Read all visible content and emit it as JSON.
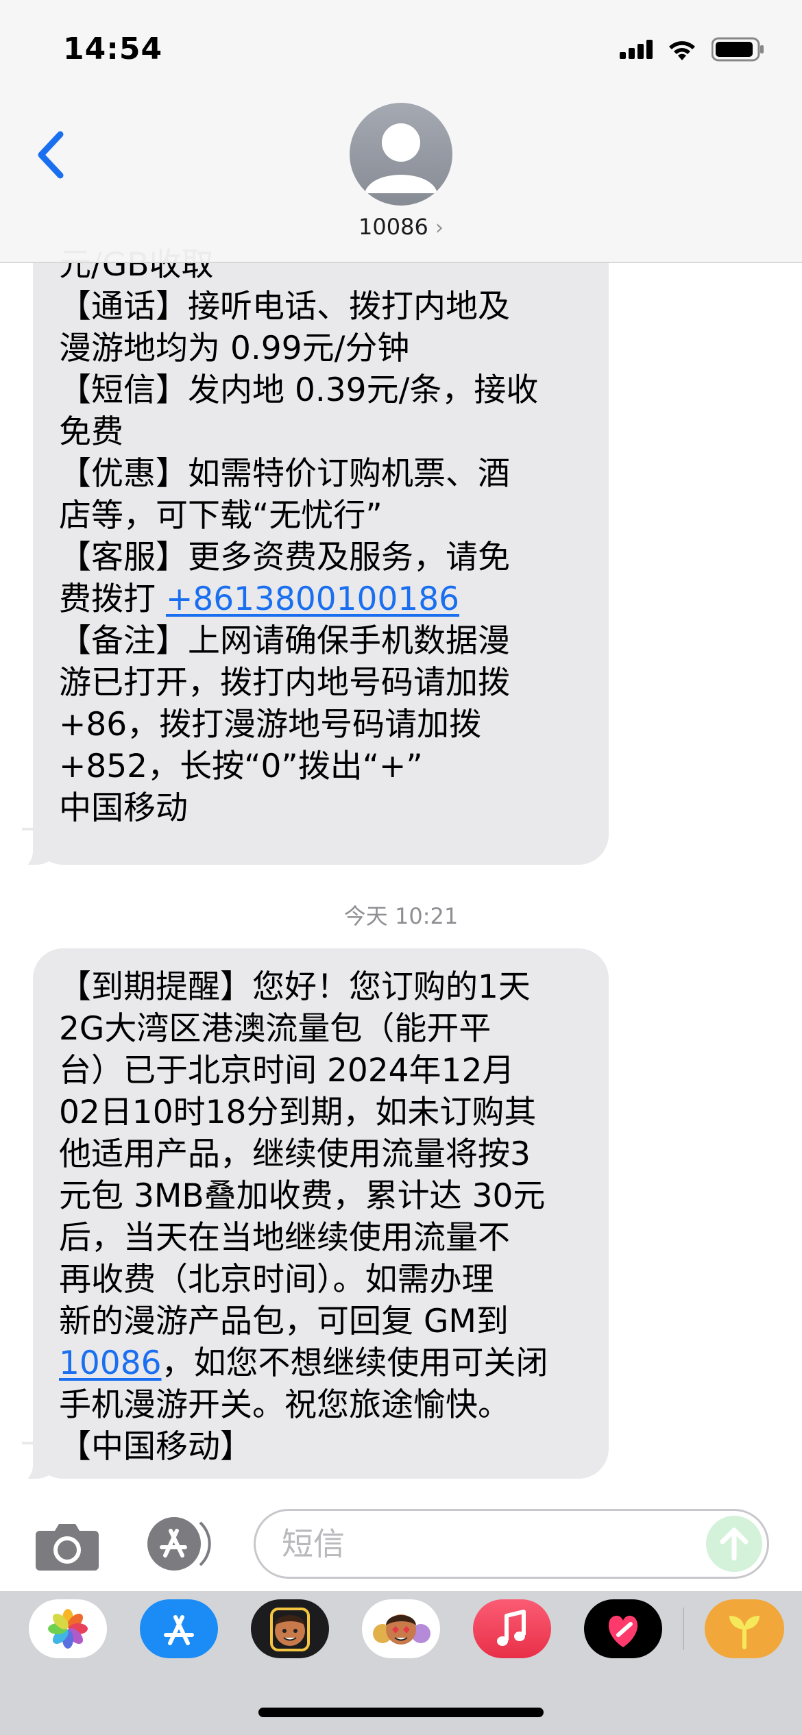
{
  "status_bar": {
    "time": "14:54"
  },
  "header": {
    "contact": "10086",
    "chevron": "›"
  },
  "messages": [
    {
      "lines": [
        "元/GB收取",
        "【通话】接听电话、拨打内地及",
        "漫游地均为 0.99元/分钟",
        "【短信】发内地 0.39元/条，接收",
        "免费",
        "【优惠】如需特价订购机票、酒",
        "店等，可下载“无忧行”",
        "【客服】更多资费及服务，请免",
        "【备注】上网请确保手机数据漫",
        "游已打开，拨打内地号码请加拨",
        "+86，拨打漫游地号码请加拨",
        "+852，长按“0”拨出“+”",
        "中国移动"
      ],
      "service_prefix": "费拨打 ",
      "service_phone": "+8613800100186"
    },
    {
      "lines": [
        "【到期提醒】您好！您订购的1天",
        "2G大湾区港澳流量包（能开平",
        "台）已于北京时间 2024年12月",
        "02日10时18分到期，如未订购其",
        "他适用产品，继续使用流量将按3",
        "元包 3MB叠加收费，累计达 30元",
        "后，当天在当地继续使用流量不",
        "再收费（北京时间）。如需办理",
        "新的漫游产品包，可回复 GM到",
        "手机漫游开关。祝您旅途愉快。",
        "【中国移动】"
      ],
      "link_number": "10086",
      "link_suffix": "，如您不想继续使用可关闭"
    }
  ],
  "timestamp": "今天 10:21",
  "composer": {
    "placeholder": "短信"
  },
  "colors": {
    "link": "#1a6ff0",
    "bubble": "#e9e9eb",
    "back": "#1a6ff0"
  },
  "drawer_apps": [
    "photos",
    "app-store",
    "memoji",
    "animoji-stickers",
    "music",
    "fitness",
    "plant-app"
  ]
}
